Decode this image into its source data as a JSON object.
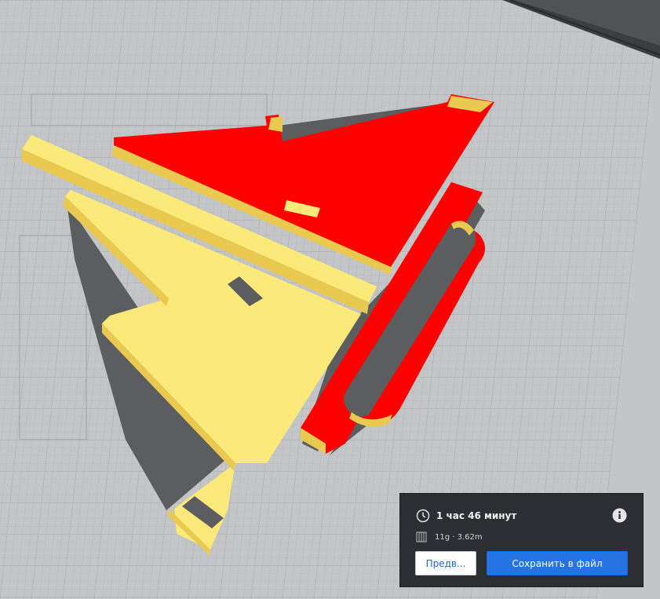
{
  "print_info": {
    "duration": "1 час 46 минут",
    "material": "11g · 3.62m"
  },
  "buttons": {
    "preview_label": "Предв...",
    "save_label": "Сохранить в файл"
  },
  "icons": {
    "clock": "clock-icon",
    "info": "info-icon",
    "spool": "filament-spool-icon"
  },
  "colors": {
    "build_plate": "#c4c5c6",
    "part_red": "#ff0000",
    "part_yellow": "#fbea7a",
    "part_edge": "#e9c94f",
    "shadow": "#5b5d5e",
    "panel_bg": "#2b2e33",
    "accent_blue": "#2673e3"
  }
}
